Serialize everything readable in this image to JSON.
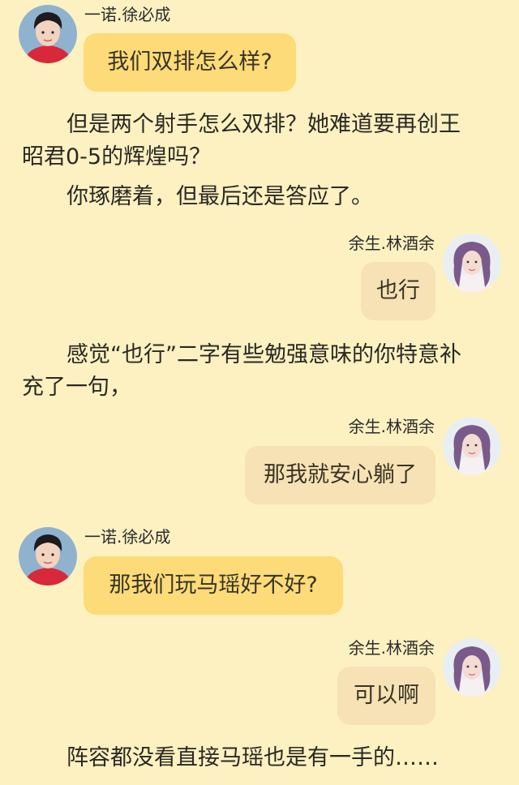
{
  "colors": {
    "background": "#fdf1c1",
    "left_bubble": "#fcdb78",
    "right_bubble": "#f6e2b4"
  },
  "senders": {
    "left": "一诺.徐必成",
    "right": "余生.林酒余"
  },
  "messages": [
    {
      "side": "left",
      "sender": "一诺.徐必成",
      "text": "我们双排怎么样?"
    },
    {
      "side": "right",
      "sender": "余生.林酒余",
      "text": "也行"
    },
    {
      "side": "right",
      "sender": "余生.林酒余",
      "text": "那我就安心躺了"
    },
    {
      "side": "left",
      "sender": "一诺.徐必成",
      "text": "那我们玩马瑶好不好?"
    },
    {
      "side": "right",
      "sender": "余生.林酒余",
      "text": "可以啊"
    }
  ],
  "narration": [
    {
      "lines": [
        "但是两个射手怎么双排？她难道要再创王",
        "昭君0-5的辉煌吗？"
      ]
    },
    {
      "lines": [
        "你琢磨着，但最后还是答应了。"
      ]
    },
    {
      "lines": [
        "感觉“也行”二字有些勉强意味的你特意补",
        "充了一句，"
      ]
    },
    {
      "lines": [
        "阵容都没看直接马瑶也是有一手的……"
      ]
    }
  ]
}
